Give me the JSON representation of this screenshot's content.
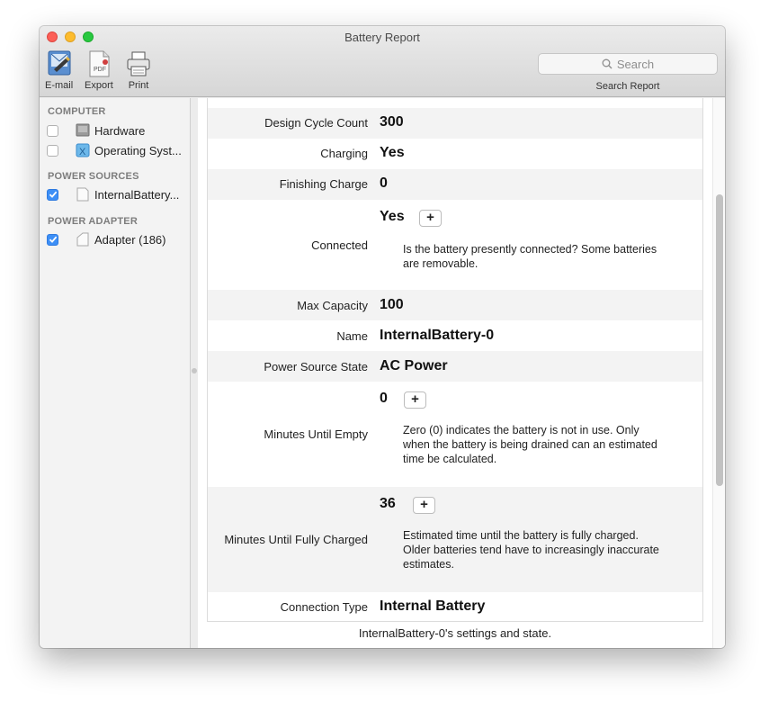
{
  "window": {
    "title": "Battery Report"
  },
  "toolbar": {
    "email_label": "E-mail",
    "export_label": "Export",
    "export_badge": "PDF",
    "print_label": "Print",
    "search_placeholder": "Search",
    "search_caption": "Search Report"
  },
  "sidebar": {
    "groups": [
      {
        "header": "COMPUTER",
        "items": [
          {
            "label": "Hardware",
            "checked": false,
            "icon": "hardware-icon"
          },
          {
            "label": "Operating Syst...",
            "checked": false,
            "icon": "os-icon"
          }
        ]
      },
      {
        "header": "POWER SOURCES",
        "items": [
          {
            "label": "InternalBattery...",
            "checked": true,
            "icon": "document-icon"
          }
        ]
      },
      {
        "header": "POWER ADAPTER",
        "items": [
          {
            "label": "Adapter (186)",
            "checked": true,
            "icon": "document-icon"
          }
        ]
      }
    ]
  },
  "report": {
    "rows": [
      {
        "key": "Design Cycle Count",
        "value": "300"
      },
      {
        "key": "Charging",
        "value": "Yes"
      },
      {
        "key": "Finishing Charge",
        "value": "0"
      },
      {
        "key": "Connected",
        "value": "Yes",
        "button": "+",
        "description": "Is the battery presently connected? Some batteries are removable."
      },
      {
        "key": "Max Capacity",
        "value": "100"
      },
      {
        "key": "Name",
        "value": "InternalBattery-0"
      },
      {
        "key": "Power Source State",
        "value": "AC Power"
      },
      {
        "key": "Minutes Until Empty",
        "value": "0",
        "button": "+",
        "description": "Zero (0) indicates the battery is not in use. Only when the battery is being drained can an estimated time be calculated."
      },
      {
        "key": "Minutes Until Fully Charged",
        "value": "36",
        "button": "+",
        "description": "Estimated time until the battery is fully charged. Older batteries tend have to increasingly inaccurate estimates."
      },
      {
        "key": "Connection Type",
        "value": "Internal Battery"
      }
    ],
    "footer": "InternalBattery-0's settings and state."
  },
  "colors": {
    "accent": "#3d8ff6",
    "row_alt": "#f3f3f3"
  }
}
